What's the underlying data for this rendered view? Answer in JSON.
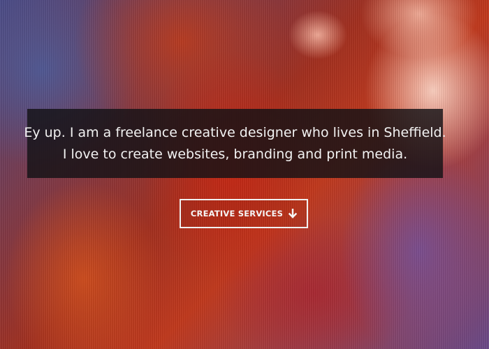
{
  "hero": {
    "intro_line_1": "Ey up. I am a freelance creative designer who lives in Sheffield.",
    "intro_line_2": "I love to create websites, branding and print media.",
    "button_label": "CREATIVE SERVICES",
    "button_icon": "arrow-down-icon"
  },
  "colors": {
    "overlay": "#141216",
    "text": "#f2f2f2",
    "button_border": "#f0f0f0"
  }
}
